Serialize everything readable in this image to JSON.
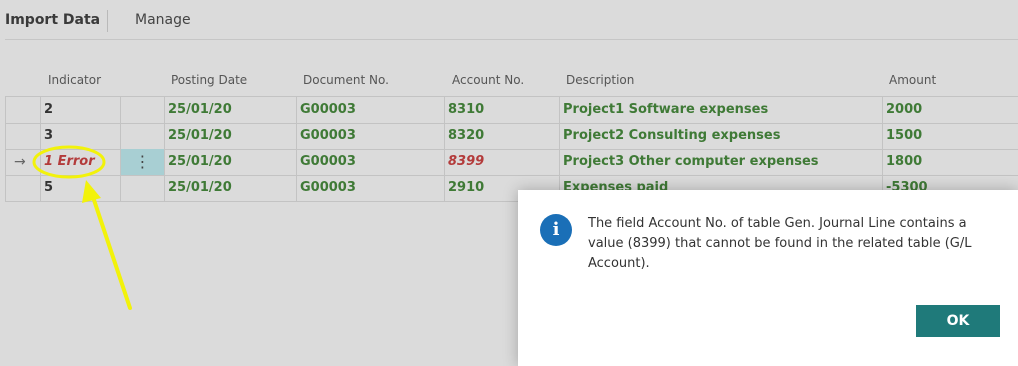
{
  "toolbar": {
    "import_label": "Import Data",
    "manage_label": "Manage"
  },
  "columns": {
    "indicator": "Indicator",
    "posting_date": "Posting Date",
    "document_no": "Document No.",
    "account_no": "Account No.",
    "description": "Description",
    "amount": "Amount"
  },
  "rows": [
    {
      "indicator": "2",
      "posting_date": "25/01/20",
      "document_no": "G00003",
      "account_no": "8310",
      "description": "Project1 Software expenses",
      "amount": "2000"
    },
    {
      "indicator": "3",
      "posting_date": "25/01/20",
      "document_no": "G00003",
      "account_no": "8320",
      "description": "Project2 Consulting expenses",
      "amount": "1500"
    },
    {
      "indicator": "1 Error",
      "posting_date": "25/01/20",
      "document_no": "G00003",
      "account_no": "8399",
      "description": "Project3 Other computer expenses",
      "amount": "1800",
      "row_marker": "→",
      "action": "⋮"
    },
    {
      "indicator": "5",
      "posting_date": "25/01/20",
      "document_no": "G00003",
      "account_no": "2910",
      "description": "Expenses paid",
      "amount": "-5300"
    }
  ],
  "dialog": {
    "icon": "i",
    "message": "The field Account No. of table Gen. Journal Line contains a value (8399) that cannot be found in the related table (G/L Account).",
    "ok_label": "OK"
  },
  "colors": {
    "accent": "#1f7a7a",
    "info": "#1a6fb7",
    "ok_text": "#3f7a36",
    "error_text": "#b33b3b",
    "annotation": "#f2f20a"
  }
}
